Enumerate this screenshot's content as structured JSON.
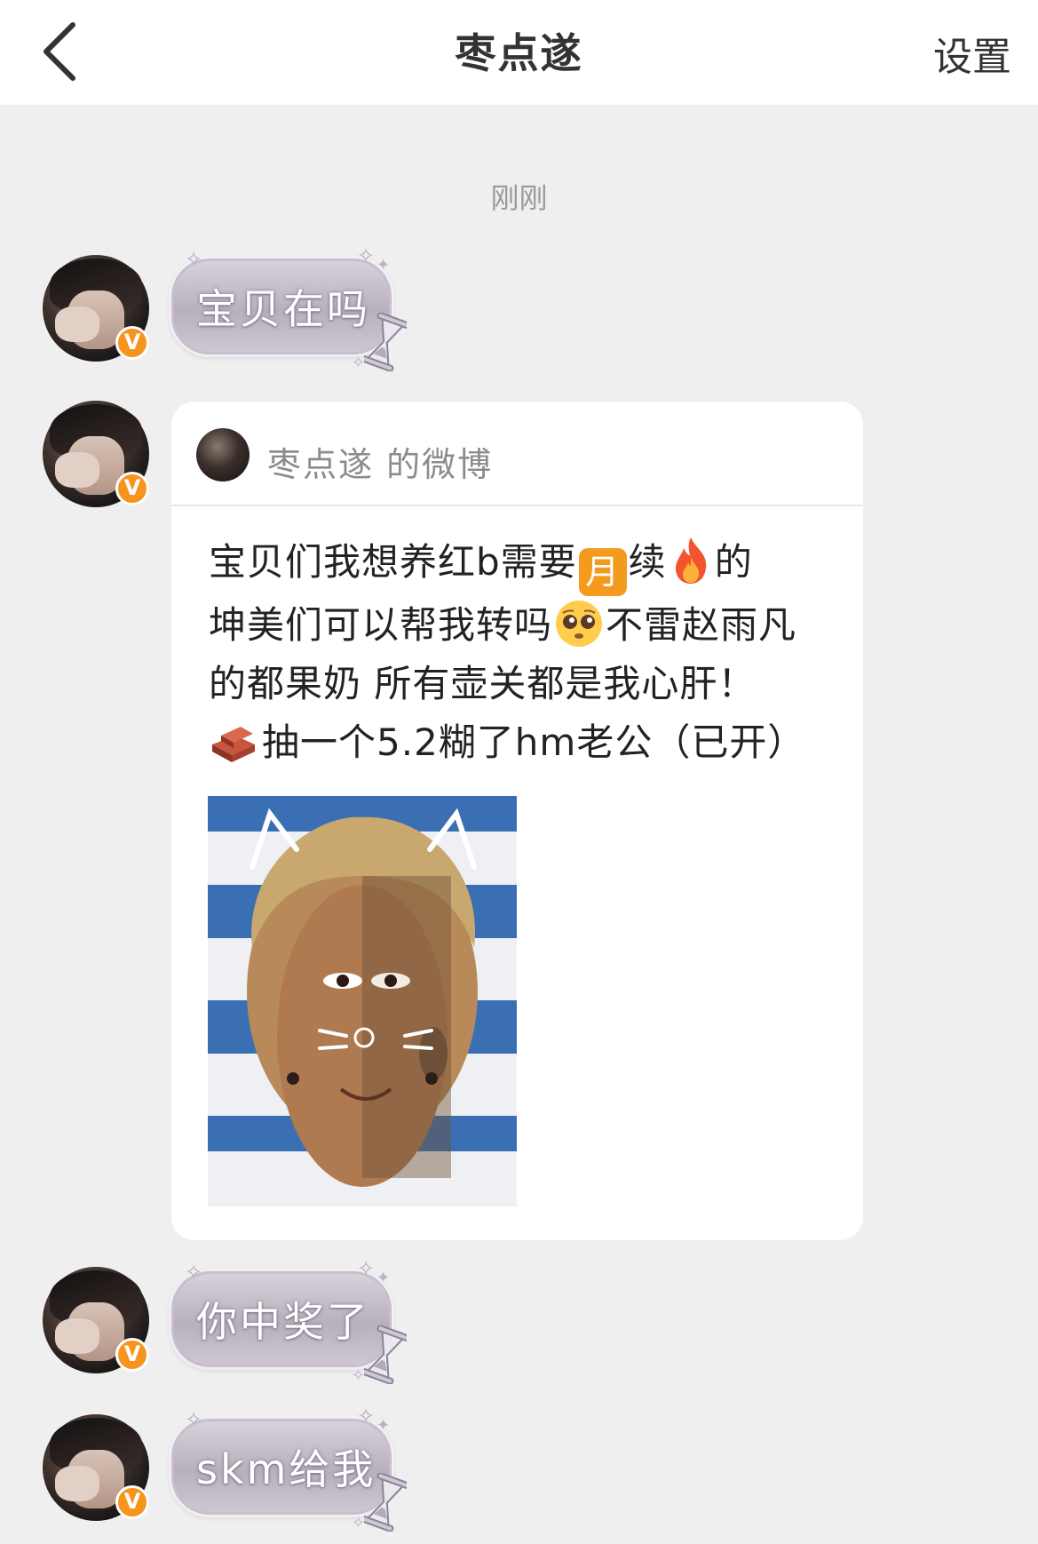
{
  "header": {
    "title": "枣点遂",
    "settings_label": "设置"
  },
  "chat": {
    "timestamp": "刚刚",
    "messages": [
      {
        "text": "宝贝在吗"
      },
      {
        "text": "你中奖了"
      },
      {
        "text": "skm给我"
      }
    ],
    "card": {
      "source": "枣点遂 的微博",
      "lines": {
        "l1a": "宝贝们我想养红b需要",
        "moon": "月",
        "l1b": "续",
        "l1c": "的",
        "l2a": "坤美们可以帮我转吗",
        "l2b": "不雷赵雨凡",
        "l3": "的都果奶 所有壶关都是我心肝！",
        "l4": "抽一个5.2糊了hm老公（已开）"
      }
    }
  },
  "icons": {
    "back": "chevron-left-icon",
    "verified": "verified-badge-icon",
    "fire": "fire-emoji-icon",
    "pleading": "pleading-face-emoji-icon",
    "brick": "brick-emoji-icon",
    "hourglass": "hourglass-icon"
  },
  "colors": {
    "header_bg": "#ffffff",
    "page_bg": "#efefef",
    "verified_badge": "#f7941d",
    "moon_emoji": "#f49b1f"
  }
}
